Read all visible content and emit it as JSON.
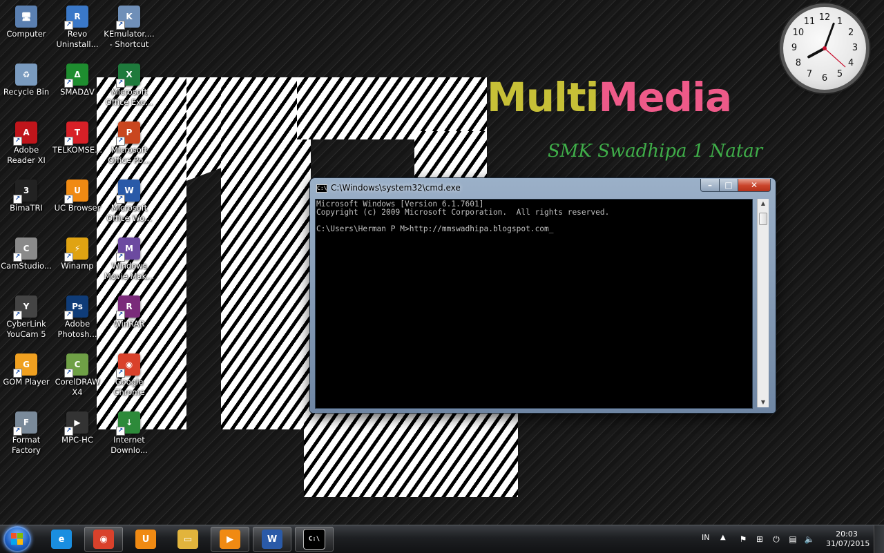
{
  "desktop": {
    "icons": [
      {
        "label": "Computer",
        "icon": "computer-icon"
      },
      {
        "label": "Revo Uninstall...",
        "icon": "revo-uninstaller-icon"
      },
      {
        "label": "KEmulator.... - Shortcut",
        "icon": "kemulator-icon"
      },
      {
        "label": "Recycle Bin",
        "icon": "recycle-bin-icon"
      },
      {
        "label": "SMADΔV",
        "icon": "smadav-icon"
      },
      {
        "label": "Microsoft Office Exc...",
        "icon": "excel-icon"
      },
      {
        "label": "Adobe Reader XI",
        "icon": "adobe-reader-icon"
      },
      {
        "label": "TELKOMSE...",
        "icon": "telkomsel-icon"
      },
      {
        "label": "Microsoft Office Po...",
        "icon": "powerpoint-icon"
      },
      {
        "label": "BimaTRI",
        "icon": "bimatri-icon"
      },
      {
        "label": "UC Browser",
        "icon": "uc-browser-icon"
      },
      {
        "label": "Microsoft Office Wo...",
        "icon": "word-icon"
      },
      {
        "label": "CamStudio...",
        "icon": "camstudio-icon"
      },
      {
        "label": "Winamp",
        "icon": "winamp-icon"
      },
      {
        "label": "Windows Movie Mak...",
        "icon": "movie-maker-icon"
      },
      {
        "label": "CyberLink YouCam 5",
        "icon": "youcam-icon"
      },
      {
        "label": "Adobe Photosh...",
        "icon": "photoshop-icon"
      },
      {
        "label": "WinRAR",
        "icon": "winrar-icon"
      },
      {
        "label": "GOM Player",
        "icon": "gom-player-icon"
      },
      {
        "label": "CorelDRAW X4",
        "icon": "coreldraw-icon"
      },
      {
        "label": "Google Chrome",
        "icon": "chrome-icon"
      },
      {
        "label": "Format Factory",
        "icon": "format-factory-icon"
      },
      {
        "label": "MPC-HC",
        "icon": "mpc-hc-icon"
      },
      {
        "label": "Internet Downlo...",
        "icon": "idm-icon"
      }
    ]
  },
  "wallpaper": {
    "logo_word1": "Multi",
    "logo_word2": "Media",
    "logo_subtitle": "SMK Swadhipa 1 Natar",
    "pattern_text": "Multimedia"
  },
  "clock": {
    "numbers": [
      "12",
      "1",
      "2",
      "3",
      "4",
      "5",
      "6",
      "7",
      "8",
      "9",
      "10",
      "11"
    ],
    "hour": 8,
    "minute": 3,
    "second": 22
  },
  "cmd": {
    "title": "C:\\Windows\\system32\\cmd.exe",
    "lines": [
      "Microsoft Windows [Version 6.1.7601]",
      "Copyright (c) 2009 Microsoft Corporation.  All rights reserved.",
      "",
      "C:\\Users\\Herman P M>http://mmswadhipa.blogspot.com_"
    ],
    "minimize_label": "–",
    "maximize_label": "□",
    "close_label": "✕"
  },
  "taskbar": {
    "items": [
      {
        "name": "internet-explorer",
        "icon": "internet-explorer-icon",
        "state": "pinned"
      },
      {
        "name": "google-chrome",
        "icon": "chrome-icon",
        "state": "running"
      },
      {
        "name": "uc-browser",
        "icon": "uc-browser-icon",
        "state": "pinned"
      },
      {
        "name": "windows-explorer",
        "icon": "folder-icon",
        "state": "pinned"
      },
      {
        "name": "media-player",
        "icon": "media-player-icon",
        "state": "running"
      },
      {
        "name": "microsoft-word",
        "icon": "word-icon",
        "state": "running"
      },
      {
        "name": "command-prompt",
        "icon": "cmd-icon",
        "state": "running"
      }
    ],
    "tray": {
      "language": "IN",
      "time": "20:03",
      "date": "31/07/2015"
    }
  },
  "colors": {
    "logo_yellow": "#c7c037",
    "logo_pink": "#ee5a89",
    "logo_green": "#3fae49",
    "console_text": "#c0c0c0"
  }
}
